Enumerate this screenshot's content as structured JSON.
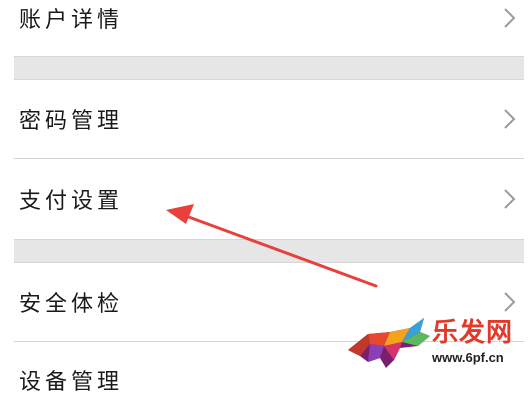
{
  "settings": {
    "items": [
      {
        "label": "账户详情"
      },
      {
        "label": "密码管理"
      },
      {
        "label": "支付设置"
      },
      {
        "label": "安全体检"
      },
      {
        "label": "设备管理"
      }
    ]
  },
  "icons": {
    "chevron": "chevron-right-icon",
    "annotation": "red-arrow-annotation"
  },
  "colors": {
    "divider": "#d5d5d5",
    "section_gap": "#e6e6e6",
    "arrow": "#e8403a",
    "watermark": "#e23a2a"
  },
  "watermark": {
    "site": "乐发网",
    "url": "www.6pf.cn"
  }
}
